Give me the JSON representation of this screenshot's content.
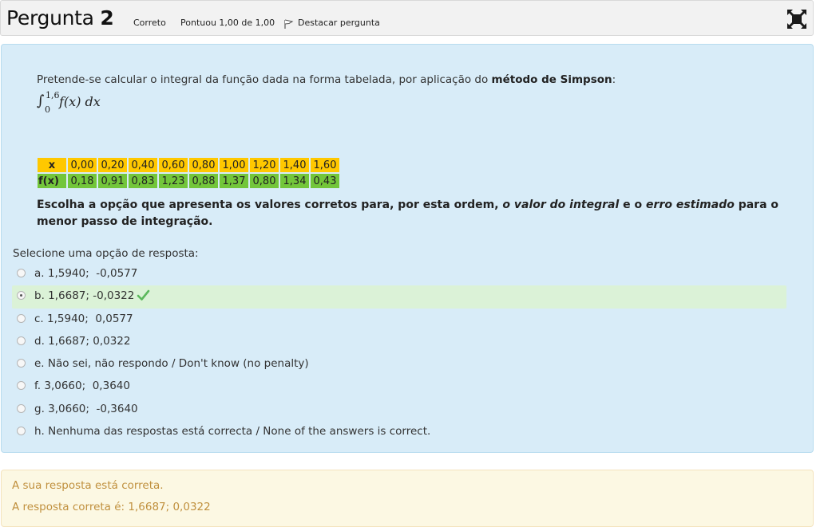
{
  "question": {
    "label": "Pergunta",
    "number": "2",
    "status": "Correto",
    "score": "Pontuou 1,00 de 1,00",
    "flag_label": "Destacar pergunta"
  },
  "icons": {
    "flag": "flag-icon",
    "expand": "expand-icon",
    "tick": "check-icon"
  },
  "formulation": {
    "intro_text": "Pretende-se calcular o integral da função dada na forma tabelada, por aplicação do ",
    "intro_bold": "método de Simpson",
    "intro_end": ":",
    "integral": {
      "upper": "1,6",
      "lower": "0",
      "expr": "f(x) dx"
    },
    "table": {
      "x_header": "x",
      "fx_header": "f(x)",
      "x_values": [
        "0,00",
        "0,20",
        "0,40",
        "0,60",
        "0,80",
        "1,00",
        "1,20",
        "1,40",
        "1,60"
      ],
      "fx_values": [
        "0,18",
        "0,91",
        "0,83",
        "1,23",
        "0,88",
        "1,37",
        "0,80",
        "1,34",
        "0,43"
      ]
    },
    "stem": {
      "part1": "Escolha a opção que apresenta os valores corretos para, por esta ordem, ",
      "em1": "o valor do integral",
      "part2": " e o ",
      "em2": "erro estimado",
      "part3": " para o menor passo de integração."
    },
    "prompt": "Selecione uma opção de resposta:",
    "options": [
      {
        "label": "a. 1,5940;  -0,0577",
        "selected": false
      },
      {
        "label": "b. 1,6687; -0,0322",
        "selected": true
      },
      {
        "label": "c. 1,5940;  0,0577",
        "selected": false
      },
      {
        "label": "d. 1,6687; 0,0322",
        "selected": false
      },
      {
        "label": "e. Não sei, não respondo / Don't know (no penalty)",
        "selected": false
      },
      {
        "label": "f. 3,0660;  0,3640",
        "selected": false
      },
      {
        "label": "g. 3,0660;  -0,3640",
        "selected": false
      },
      {
        "label": "h. Nenhuma das respostas está correcta / None of the answers is correct.",
        "selected": false
      }
    ]
  },
  "feedback": {
    "line1": "A sua resposta está correta.",
    "line2": "A resposta correta é: 1,6687; 0,0322"
  },
  "colors": {
    "table_x_row": "#ffc800",
    "table_fx_row": "#73c63a",
    "correct_highlight": "#dbf2d7",
    "feedback_text": "#c0903e"
  }
}
